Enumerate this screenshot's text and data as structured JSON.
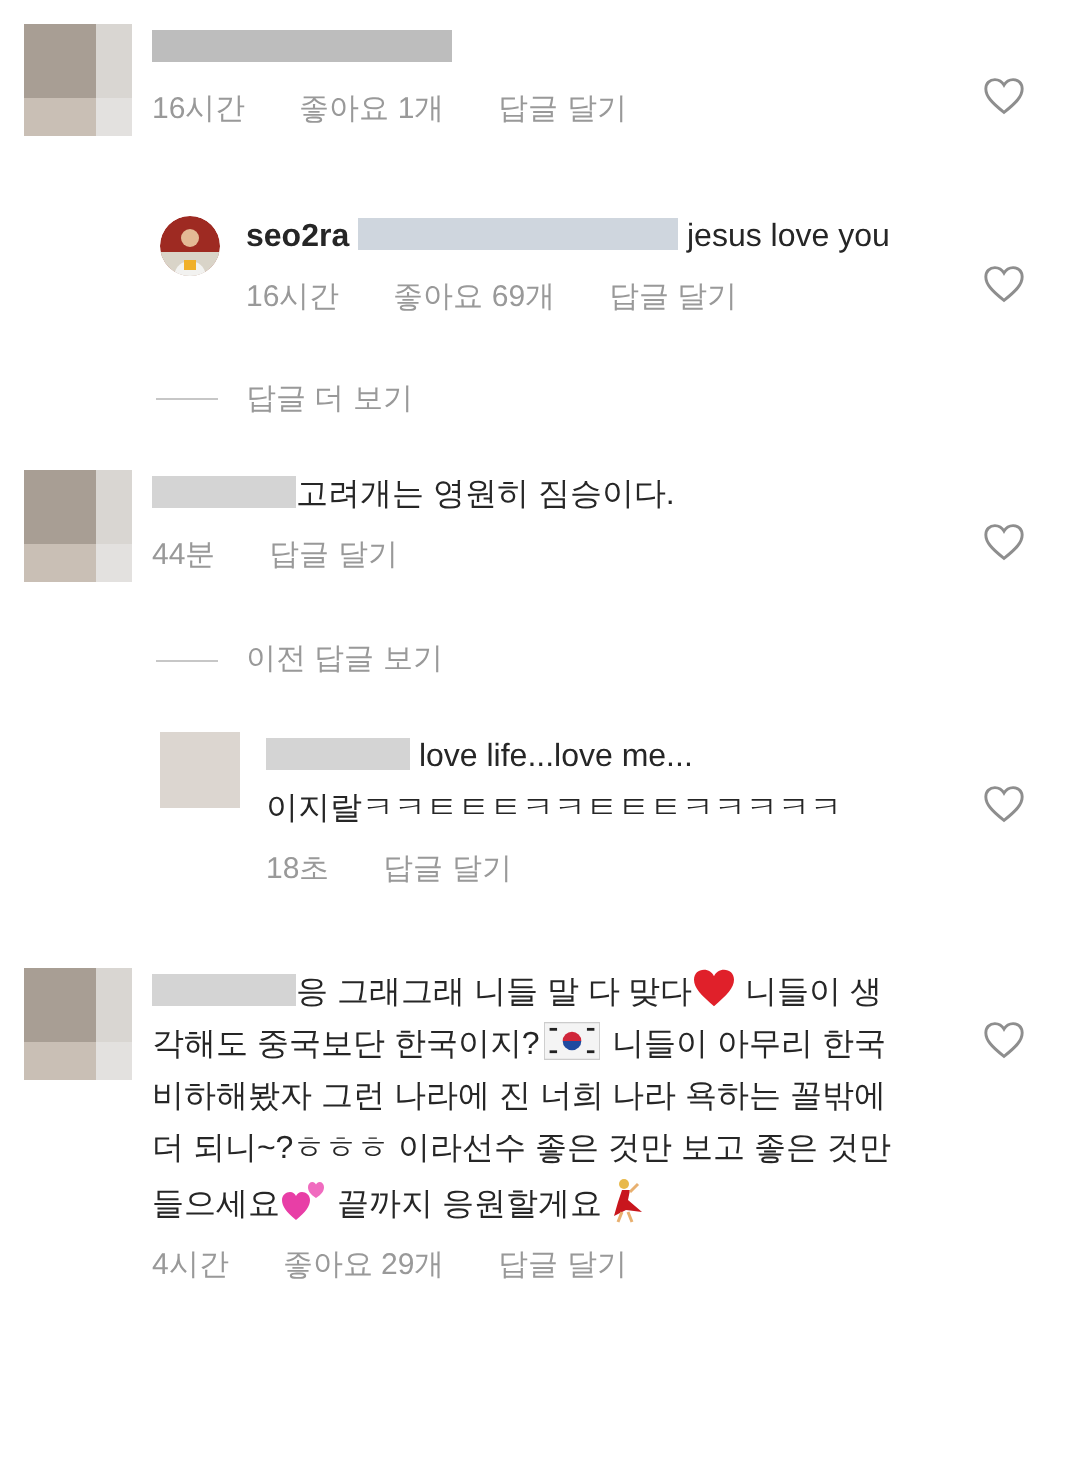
{
  "comments": [
    {
      "kind": "comment",
      "avatar": {
        "kind": "blurred"
      },
      "name_redacted": true,
      "meta": {
        "time": "16시간",
        "likes": "좋아요 1개",
        "reply": "답글 달기"
      },
      "liked": false
    },
    {
      "kind": "reply",
      "username": "seo2ra",
      "name_redacted": true,
      "parts": [
        {
          "kind": "text",
          "text": " jesus love you"
        }
      ],
      "meta": {
        "time": "16시간",
        "likes": "좋아요 69개",
        "reply": "답글 달기"
      },
      "liked": false
    },
    {
      "kind": "link",
      "label": "답글 더 보기"
    },
    {
      "kind": "comment",
      "avatar": {
        "kind": "blurred"
      },
      "name_redacted": true,
      "parts": [
        {
          "kind": "text",
          "text": "고려개는 영원히 짐승이다."
        }
      ],
      "meta": {
        "time": "44분",
        "reply": "답글 달기"
      },
      "liked": false
    },
    {
      "kind": "link",
      "label": "이전 답글 보기"
    },
    {
      "kind": "reply",
      "avatar": {
        "kind": "covered"
      },
      "name_redacted": true,
      "parts": [
        {
          "kind": "text",
          "text": " love life...love me...\n이지랄ㅋㅋㅌㅌㅌㅋㅋㅌㅌㅌㅋㅋㅋㅋㅋ"
        }
      ],
      "meta": {
        "time": "18초",
        "reply": "답글 달기"
      },
      "liked": false
    },
    {
      "kind": "comment",
      "avatar": {
        "kind": "blurred"
      },
      "name_redacted": true,
      "parts": [
        {
          "kind": "text",
          "text": "응 그래그래 니들 말 다 맞다"
        },
        {
          "kind": "heart"
        },
        {
          "kind": "text",
          "text": " 니들이 생각해도 중국보단 한국이지?"
        },
        {
          "kind": "flag"
        },
        {
          "kind": "text",
          "text": " 니들이 아무리 한국 비하해봤자 그런 나라에 진 너희 나라 욕하는 꼴밖에 더 되니~?ㅎㅎㅎ 이라선수 좋은 것만 보고 좋은 것만 들으세요"
        },
        {
          "kind": "hearts"
        },
        {
          "kind": "text",
          "text": " 끝까지 응원할게요"
        },
        {
          "kind": "dancer"
        }
      ],
      "meta": {
        "time": "4시간",
        "likes": "좋아요 29개",
        "reply": "답글 달기"
      },
      "liked": false
    }
  ]
}
